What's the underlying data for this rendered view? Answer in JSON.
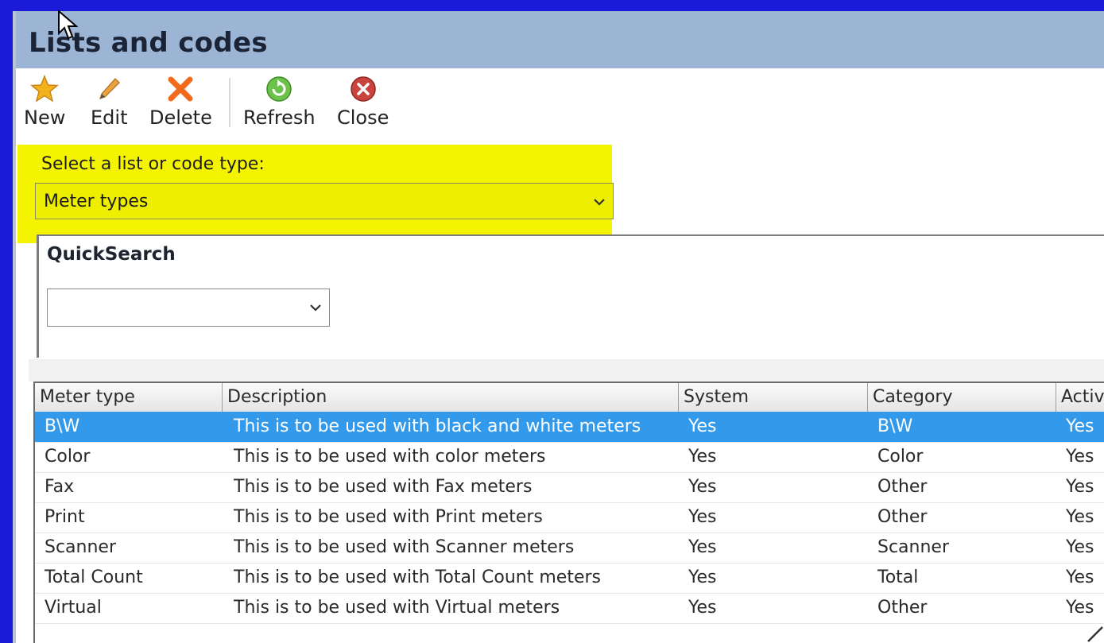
{
  "window": {
    "title": "Lists and codes"
  },
  "toolbar": {
    "items": [
      {
        "label": "New",
        "icon": "star-icon"
      },
      {
        "label": "Edit",
        "icon": "pencil-icon"
      },
      {
        "label": "Delete",
        "icon": "delete-x-icon"
      },
      {
        "label": "Refresh",
        "icon": "refresh-icon"
      },
      {
        "label": "Close",
        "icon": "close-icon"
      }
    ]
  },
  "type_selector": {
    "label": "Select a list or code type:",
    "value": "Meter types",
    "highlight_color": "#f4f400"
  },
  "quicksearch": {
    "title": "QuickSearch",
    "value": ""
  },
  "grid": {
    "columns": [
      "Meter type",
      "Description",
      "System",
      "Category",
      "Activ"
    ],
    "rows": [
      {
        "cells": [
          "B\\W",
          "This is to be used with black and white meters",
          "Yes",
          "B\\W",
          "Yes"
        ],
        "selected": true
      },
      {
        "cells": [
          "Color",
          "This is to be used with color meters",
          "Yes",
          "Color",
          "Yes"
        ],
        "selected": false
      },
      {
        "cells": [
          "Fax",
          "This is to be used with Fax meters",
          "Yes",
          "Other",
          "Yes"
        ],
        "selected": false
      },
      {
        "cells": [
          "Print",
          "This is to be used with Print meters",
          "Yes",
          "Other",
          "Yes"
        ],
        "selected": false
      },
      {
        "cells": [
          "Scanner",
          "This is to be used with Scanner meters",
          "Yes",
          "Scanner",
          "Yes"
        ],
        "selected": false
      },
      {
        "cells": [
          "Total Count",
          "This is to be used with Total Count meters",
          "Yes",
          "Total",
          "Yes"
        ],
        "selected": false
      },
      {
        "cells": [
          "Virtual",
          "This is to be used with Virtual meters",
          "Yes",
          "Other",
          "Yes"
        ],
        "selected": false
      }
    ],
    "selection_color": "#3399ea"
  },
  "colors": {
    "frame": "#1a1ad8",
    "title_bar": "#9db5d4"
  }
}
